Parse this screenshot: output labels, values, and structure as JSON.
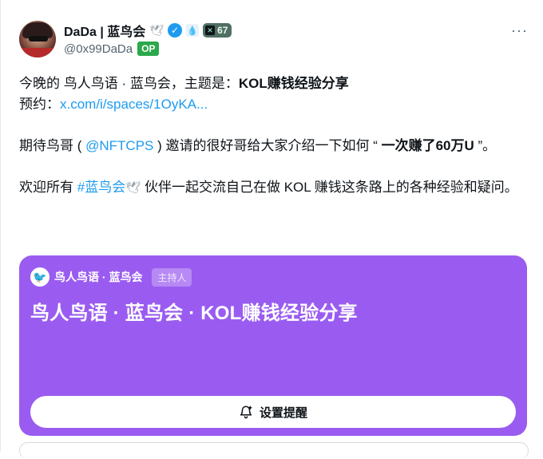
{
  "author": {
    "display_name": "DaDa | 蓝鸟会",
    "handle": "@0x99DaDa",
    "op_label": "OP",
    "x_badge_count": "67",
    "verified_icon": "verified-check-icon"
  },
  "tweet": {
    "line1_prefix": "今晚的 鸟人鸟语 · 蓝鸟会，主题是：",
    "line1_bold": "KOL赚钱经验分享",
    "line2_prefix": "预约：",
    "line2_link": "x.com/i/spaces/1OyKA...",
    "line3_prefix": "期待鸟哥 ( ",
    "line3_mention": "@NFTCPS",
    "line3_middle": " ) 邀请的很好哥给大家介绍一下如何 “ ",
    "line3_bold": "一次赚了60万U",
    "line3_suffix": " ”。",
    "line4_prefix": "欢迎所有 ",
    "line4_hashtag": "#蓝鸟会",
    "line4_suffix": " 伙伴一起交流自己在做 KOL 赚钱这条路上的各种经验和疑问。"
  },
  "space_card": {
    "host_name": "鸟人鸟语 · 蓝鸟会",
    "host_tag": "主持人",
    "title": "鸟人鸟语 · 蓝鸟会 · KOL赚钱经验分享",
    "remind_label": "设置提醒",
    "background_color": "#9a5cf0"
  },
  "colors": {
    "link": "#1d9bf0",
    "verified": "#1d9bf0",
    "op_badge": "#2aa84a"
  }
}
